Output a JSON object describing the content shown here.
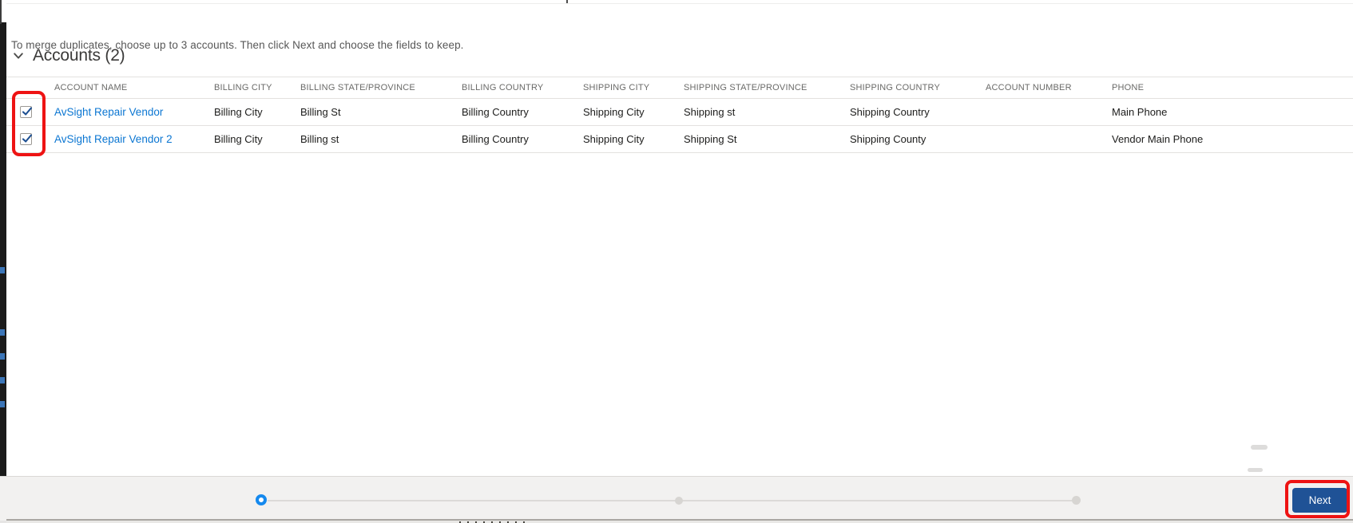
{
  "page": {
    "instruction": "To merge duplicates, choose up to 3 accounts. Then click Next and choose the fields to keep.",
    "section_title": "Accounts (2)"
  },
  "table": {
    "columns": [
      "ACCOUNT NAME",
      "BILLING CITY",
      "BILLING STATE/PROVINCE",
      "BILLING COUNTRY",
      "SHIPPING CITY",
      "SHIPPING STATE/PROVINCE",
      "SHIPPING COUNTRY",
      "ACCOUNT NUMBER",
      "PHONE"
    ],
    "rows": [
      {
        "selected": true,
        "cells": [
          "AvSight Repair Vendor",
          "Billing City",
          "Billing St",
          "Billing Country",
          "Shipping City",
          "Shipping st",
          "Shipping Country",
          "",
          "Main Phone"
        ]
      },
      {
        "selected": true,
        "cells": [
          "AvSight Repair Vendor 2",
          "Billing City",
          "Billing st",
          "Billing Country",
          "Shipping City",
          "Shipping St",
          "Shipping County",
          "",
          "Vendor Main Phone"
        ]
      }
    ]
  },
  "footer": {
    "next_label": "Next",
    "progress": {
      "total_steps": 3,
      "current_step": 1
    }
  },
  "icons": {
    "chevron": "chevron-down",
    "check": "check-mark"
  },
  "colors": {
    "link": "#0b76d2",
    "next_button_bg": "#1f5296",
    "next_button_text": "#ffffff",
    "annotation_red": "#ee1313",
    "progress_active": "#1589ee",
    "checkbox_check": "#1d4f91"
  }
}
